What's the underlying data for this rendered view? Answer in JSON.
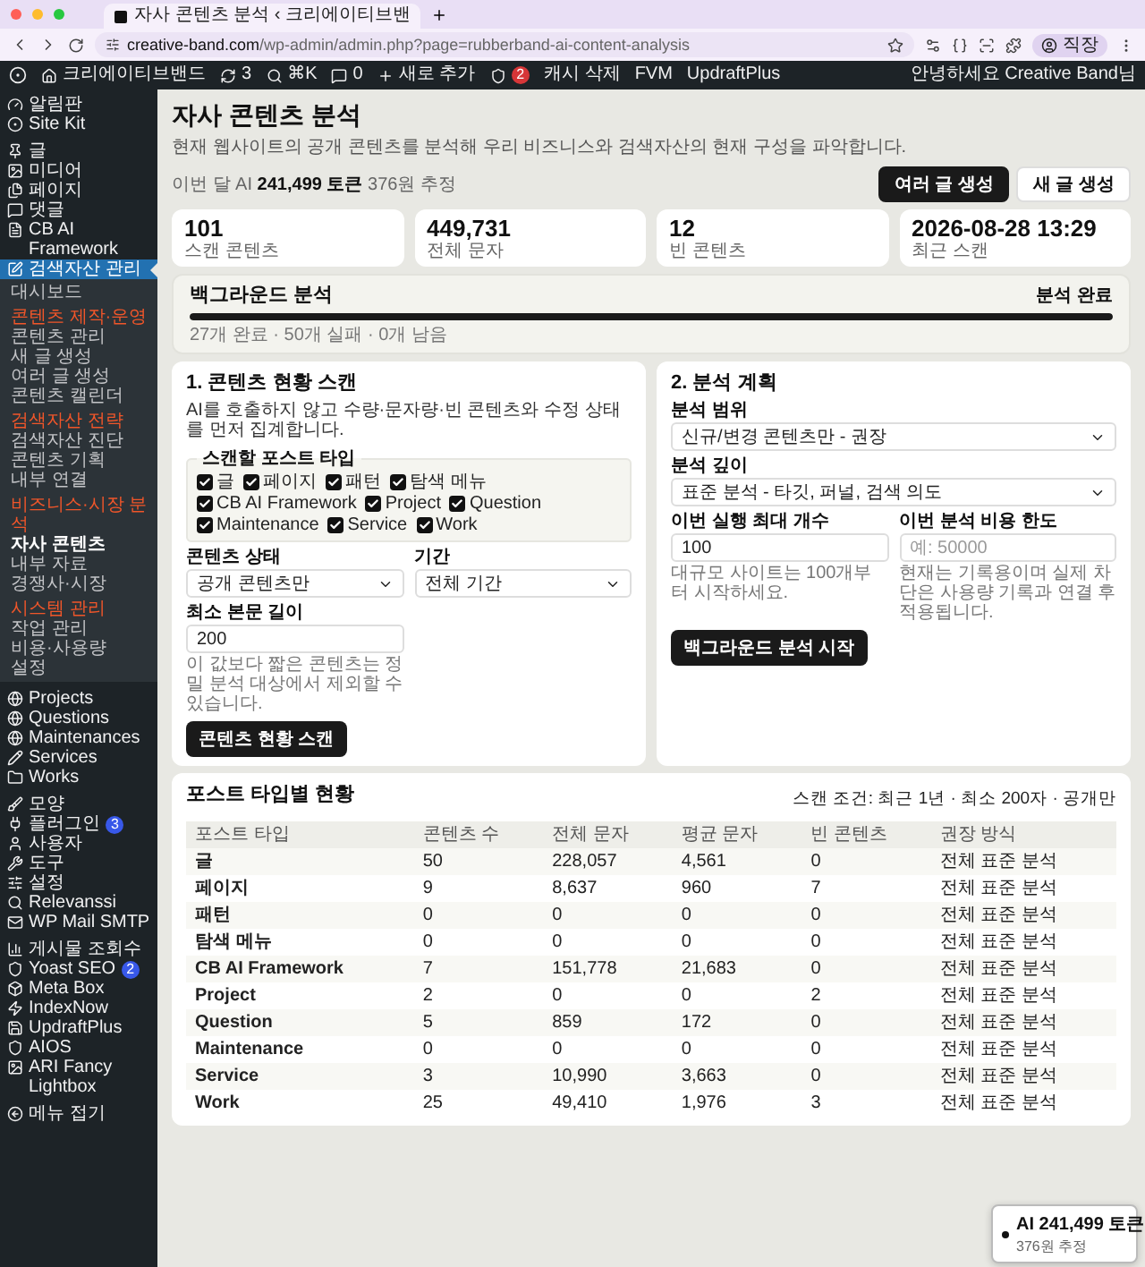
{
  "browser": {
    "tab_title": "자사 콘텐츠 분석 ‹ 크리에이티브밴",
    "url_host": "creative-band.com",
    "url_path": "/wp-admin/admin.php?page=rubberband-ai-content-analysis",
    "profile": "직장"
  },
  "admin_bar": {
    "site": "크리에이티브밴드",
    "updates": "3",
    "search": "⌘K",
    "comments": "0",
    "new": "새로 추가",
    "yoast_badge": "2",
    "links": [
      "캐시 삭제",
      "FVM",
      "UpdraftPlus"
    ],
    "greeting": "안녕하세요 Creative Band님"
  },
  "sidebar": {
    "sections": [
      {
        "items": [
          {
            "label": "알림판",
            "selected": false
          },
          {
            "label": "Site Kit",
            "selected": false
          }
        ]
      },
      {
        "items": [
          {
            "label": "글",
            "selected": false
          },
          {
            "label": "미디어",
            "selected": false
          },
          {
            "label": "페이지",
            "selected": false
          },
          {
            "label": "댓글",
            "selected": false
          },
          {
            "label": "CB AI Framework",
            "selected": false
          },
          {
            "label": "검색자산 관리",
            "selected": true,
            "submenu": [
              {
                "kind": "link",
                "label": "대시보드",
                "selected": false
              },
              {
                "kind": "header",
                "label": "콘텐츠 제작·운영"
              },
              {
                "kind": "link",
                "label": "콘텐츠 관리",
                "selected": false
              },
              {
                "kind": "link",
                "label": "새 글 생성",
                "selected": false
              },
              {
                "kind": "link",
                "label": "여러 글 생성",
                "selected": false
              },
              {
                "kind": "link",
                "label": "콘텐츠 캘린더",
                "selected": false
              },
              {
                "kind": "header",
                "label": "검색자산 전략"
              },
              {
                "kind": "link",
                "label": "검색자산 진단",
                "selected": false
              },
              {
                "kind": "link",
                "label": "콘텐츠 기획",
                "selected": false
              },
              {
                "kind": "link",
                "label": "내부 연결",
                "selected": false
              },
              {
                "kind": "header",
                "label": "비즈니스·시장 분석"
              },
              {
                "kind": "link",
                "label": "자사 콘텐츠",
                "selected": true
              },
              {
                "kind": "link",
                "label": "내부 자료",
                "selected": false
              },
              {
                "kind": "link",
                "label": "경쟁사·시장",
                "selected": false
              },
              {
                "kind": "header",
                "label": "시스템 관리"
              },
              {
                "kind": "link",
                "label": "작업 관리",
                "selected": false
              },
              {
                "kind": "link",
                "label": "비용·사용량",
                "selected": false
              },
              {
                "kind": "link",
                "label": "설정",
                "selected": false
              }
            ]
          }
        ]
      },
      {
        "items": [
          {
            "label": "Projects",
            "selected": false
          },
          {
            "label": "Questions",
            "selected": false
          },
          {
            "label": "Maintenances",
            "selected": false
          },
          {
            "label": "Services",
            "selected": false
          },
          {
            "label": "Works",
            "selected": false
          }
        ]
      },
      {
        "items": [
          {
            "label": "모양",
            "selected": false
          },
          {
            "label": "플러그인",
            "selected": false,
            "badge": "3"
          },
          {
            "label": "사용자",
            "selected": false
          },
          {
            "label": "도구",
            "selected": false
          },
          {
            "label": "설정",
            "selected": false
          },
          {
            "label": "Relevanssi",
            "selected": false
          },
          {
            "label": "WP Mail SMTP",
            "selected": false
          }
        ]
      },
      {
        "items": [
          {
            "label": "게시물 조회수",
            "selected": false
          },
          {
            "label": "Yoast SEO",
            "selected": false,
            "badge": "2"
          },
          {
            "label": "Meta Box",
            "selected": false
          },
          {
            "label": "IndexNow",
            "selected": false
          },
          {
            "label": "UpdraftPlus",
            "selected": false
          },
          {
            "label": "AIOS",
            "selected": false
          },
          {
            "label": "ARI Fancy Lightbox",
            "selected": false
          }
        ]
      }
    ],
    "collapse": "메뉴 접기"
  },
  "page": {
    "title": "자사 콘텐츠 분석",
    "description": "현재 웹사이트의 공개 콘텐츠를 분석해 우리 비즈니스와 검색자산의 현재 구성을 파악합니다.",
    "usage": "이번 달 AI **241,499 토큰** 376원 추정",
    "buttons": [
      {
        "label": "여러 글 생성",
        "kind": "primary"
      },
      {
        "label": "새 글 생성",
        "kind": "secondary"
      }
    ]
  },
  "stats": [
    {
      "value": "101",
      "label": "스캔 콘텐츠"
    },
    {
      "value": "449,731",
      "label": "전체 문자"
    },
    {
      "value": "12",
      "label": "빈 콘텐츠"
    },
    {
      "value": "2026-08-28 13:29",
      "label": "최근 스캔"
    }
  ],
  "background": {
    "title": "백그라운드 분석",
    "status": "분석 완료",
    "level": 1,
    "summary": "27개 완료 · 50개 실패 · 0개 남음"
  },
  "scan": {
    "title": "1. 콘텐츠 현황 스캔",
    "description": "AI를 호출하지 않고 수량·문자량·빈 콘텐츠와 수정 상태를 먼저 집계합니다.",
    "legend": "스캔할 포스트 타입",
    "post_types": [
      {
        "label": "글",
        "checked": true
      },
      {
        "label": "페이지",
        "checked": true
      },
      {
        "label": "패턴",
        "checked": true
      },
      {
        "label": "탐색 메뉴",
        "checked": true
      },
      {
        "label": "CB AI Framework",
        "checked": true
      },
      {
        "label": "Project",
        "checked": true
      },
      {
        "label": "Question",
        "checked": true
      },
      {
        "label": "Maintenance",
        "checked": true
      },
      {
        "label": "Service",
        "checked": true
      },
      {
        "label": "Work",
        "checked": true
      }
    ],
    "status_label": "콘텐츠 상태",
    "status_value": "공개 콘텐츠만",
    "period_label": "기간",
    "period_value": "전체 기간",
    "min_label": "최소 본문 길이",
    "min_value": "200",
    "min_help": "이 값보다 짧은 콘텐츠는 정밀 분석 대상에서 제외할 수 있습니다.",
    "button": "콘텐츠 현황 스캔"
  },
  "plan": {
    "title": "2. 분석 계획",
    "scope_label": "분석 범위",
    "scope_value": "신규/변경 콘텐츠만 - 권장",
    "depth_label": "분석 깊이",
    "depth_value": "표준 분석 - 타깃, 퍼널, 검색 의도",
    "max_label": "이번 실행 최대 개수",
    "max_value": "100",
    "max_help": "대규모 사이트는 100개부터 시작하세요.",
    "cost_label": "이번 분석 비용 한도",
    "cost_placeholder": "예: 50000",
    "cost_help": "현재는 기록용이며 실제 차단은 사용량 기록과 연결 후 적용됩니다.",
    "button": "백그라운드 분석 시작"
  },
  "table": {
    "title": "포스트 타입별 현황",
    "conditions": "스캔 조건: 최근 1년 · 최소 200자 · 공개만",
    "columns": [
      "포스트 타입",
      "콘텐츠 수",
      "전체 문자",
      "평균 문자",
      "빈 콘텐츠",
      "권장 방식"
    ],
    "rows": [
      [
        "글",
        "50",
        "228,057",
        "4,561",
        "0",
        "전체 표준 분석"
      ],
      [
        "페이지",
        "9",
        "8,637",
        "960",
        "7",
        "전체 표준 분석"
      ],
      [
        "패턴",
        "0",
        "0",
        "0",
        "0",
        "전체 표준 분석"
      ],
      [
        "탐색 메뉴",
        "0",
        "0",
        "0",
        "0",
        "전체 표준 분석"
      ],
      [
        "CB AI Framework",
        "7",
        "151,778",
        "21,683",
        "0",
        "전체 표준 분석"
      ],
      [
        "Project",
        "2",
        "0",
        "0",
        "2",
        "전체 표준 분석"
      ],
      [
        "Question",
        "5",
        "859",
        "172",
        "0",
        "전체 표준 분석"
      ],
      [
        "Maintenance",
        "0",
        "0",
        "0",
        "0",
        "전체 표준 분석"
      ],
      [
        "Service",
        "3",
        "10,990",
        "3,663",
        "0",
        "전체 표준 분석"
      ],
      [
        "Work",
        "25",
        "49,410",
        "1,976",
        "3",
        "전체 표준 분석"
      ]
    ]
  },
  "toast": {
    "title": "AI 241,499 토큰",
    "subtitle": "376원 추정"
  }
}
